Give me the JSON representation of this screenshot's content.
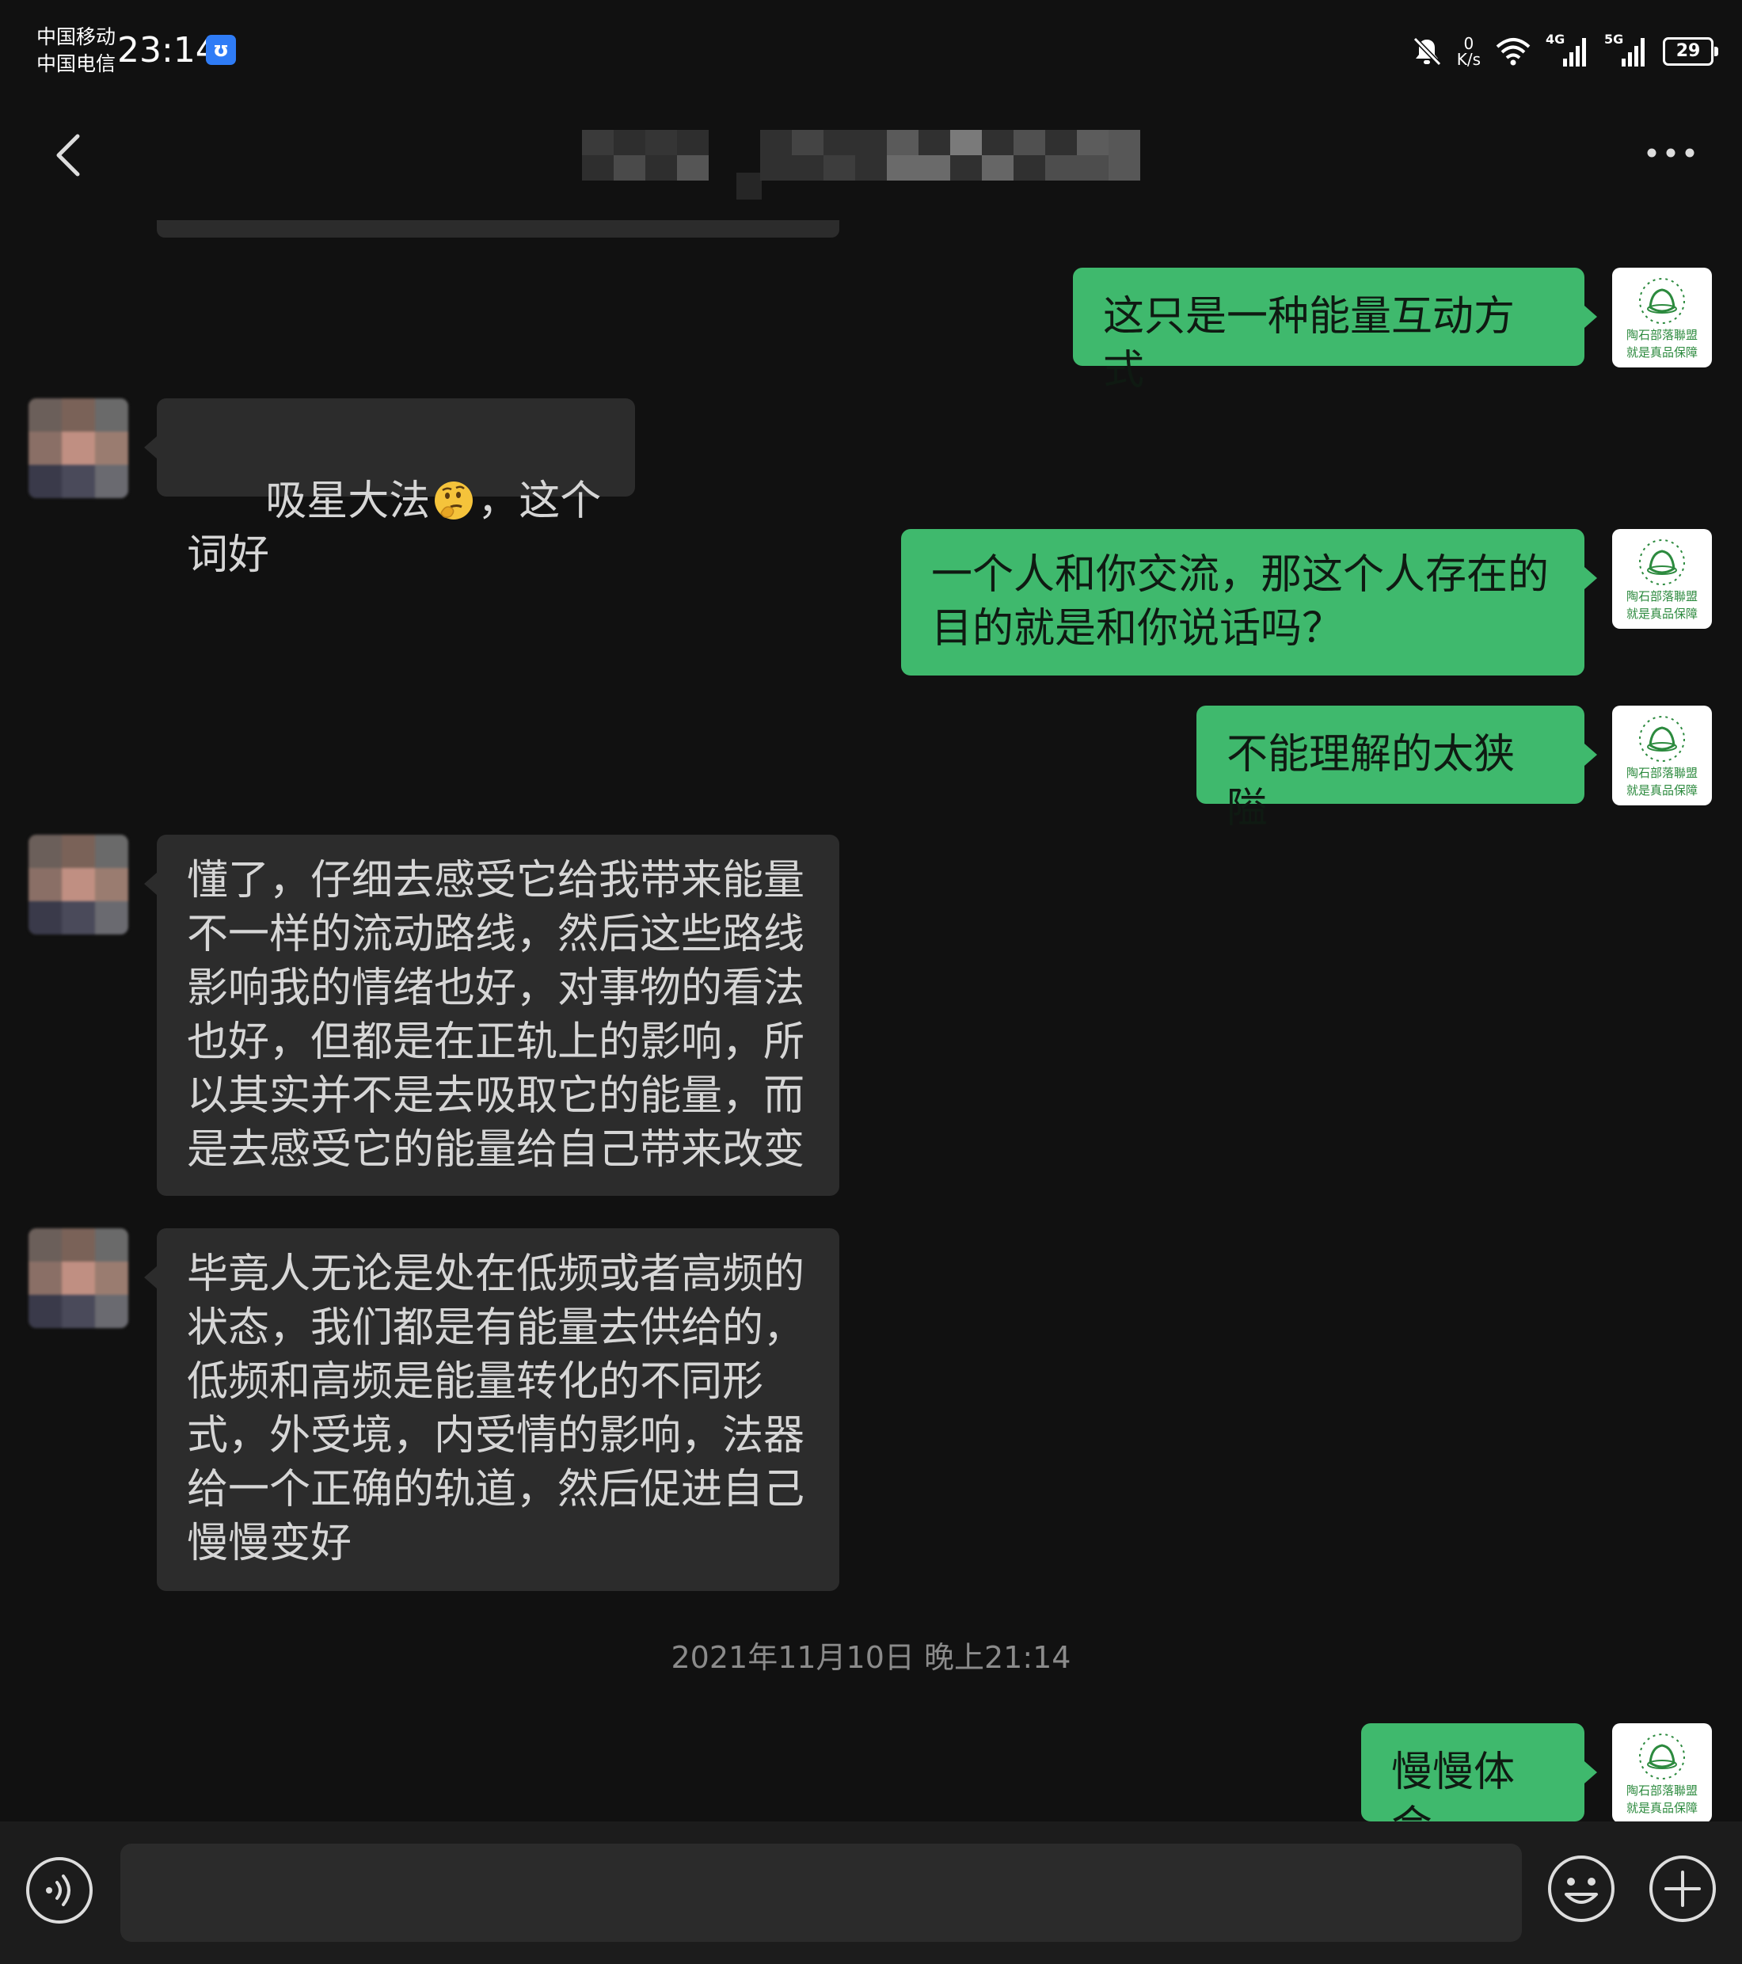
{
  "status_bar": {
    "carrier_1": "中国移动",
    "carrier_2": "中国电信",
    "time": "23:14",
    "net_speed_value": "0",
    "net_speed_unit": "K/s",
    "signal_1_label": "4G",
    "signal_2_label": "5G",
    "battery": "29"
  },
  "header": {
    "back_icon": "chevron-left-icon",
    "more_icon": "more-dots-icon"
  },
  "colors": {
    "background": "#111111",
    "outgoing_bubble": "#3fb96d",
    "incoming_bubble": "#2c2c2c",
    "timestamp_text": "#8b8b8b",
    "input_bar": "#1c1c1c"
  },
  "self_avatar": {
    "line_1": "陶石部落聯盟",
    "line_2": "就是真品保障"
  },
  "messages": [
    {
      "direction": "out",
      "text": "这只是一种能量互动方式"
    },
    {
      "direction": "in",
      "text_before": "吸星大法",
      "emoji": "thinking-face-emoji",
      "text_after": "，这个词好"
    },
    {
      "direction": "out",
      "text": "一个人和你交流，那这个人存在的目的就是和你说话吗？"
    },
    {
      "direction": "out",
      "text": "不能理解的太狭隘"
    },
    {
      "direction": "in",
      "text": "懂了，仔细去感受它给我带来能量不一样的流动路线，然后这些路线影响我的情绪也好，对事物的看法也好，但都是在正轨上的影响，所以其实并不是去吸取它的能量，而是去感受它的能量给自己带来改变"
    },
    {
      "direction": "in",
      "text": "毕竟人无论是处在低频或者高频的状态，我们都是有能量去供给的，低频和高频是能量转化的不同形式，外受境，内受情的影响，法器给一个正确的轨道，然后促进自己慢慢变好"
    },
    {
      "type": "timestamp",
      "text": "2021年11月10日 晚上21:14"
    },
    {
      "direction": "out",
      "text": "慢慢体会"
    }
  ],
  "input_bar": {
    "voice_icon": "voice-icon",
    "input_value": "",
    "emoji_icon": "smiley-icon",
    "plus_icon": "plus-icon"
  }
}
